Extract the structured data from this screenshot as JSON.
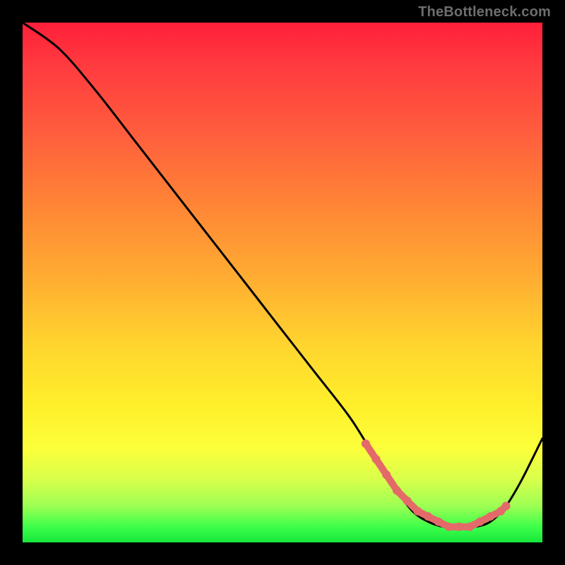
{
  "watermark": "TheBottleneck.com",
  "colors": {
    "background": "#000000",
    "curve": "#000000",
    "marker": "#e46a6a",
    "gradient_top": "#ff1f3a",
    "gradient_bottom": "#16e73b"
  },
  "chart_data": {
    "type": "line",
    "title": "",
    "xlabel": "",
    "ylabel": "",
    "xlim": [
      0,
      100
    ],
    "ylim": [
      0,
      100
    ],
    "series": [
      {
        "name": "bottleneck-curve",
        "x": [
          0,
          7,
          14,
          21,
          28,
          35,
          42,
          49,
          56,
          63,
          68,
          72,
          75,
          78,
          81,
          84,
          87,
          90,
          93,
          96,
          100
        ],
        "values": [
          100,
          95,
          87,
          78,
          69,
          60,
          51,
          42,
          33,
          24,
          16,
          10,
          6,
          4,
          3,
          3,
          3,
          4,
          7,
          12,
          20
        ]
      }
    ],
    "markers": {
      "name": "highlighted-region",
      "x": [
        66,
        68,
        70,
        72,
        74,
        76,
        78,
        80,
        82,
        84,
        86,
        88,
        90,
        92,
        93
      ],
      "values": [
        19,
        16,
        13,
        10,
        8,
        6,
        5,
        4,
        3,
        3,
        3,
        4,
        5,
        6,
        7
      ]
    }
  }
}
